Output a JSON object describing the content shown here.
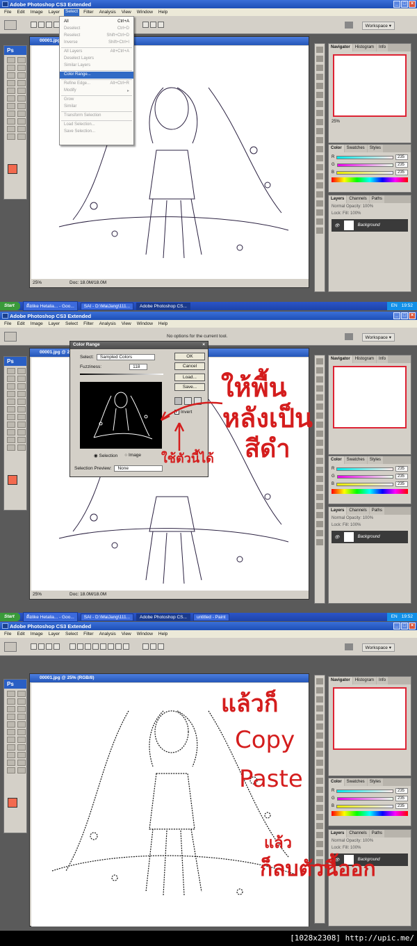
{
  "app": {
    "title": "Adobe Photoshop CS3 Extended",
    "workspace_label": "Workspace ▾",
    "ps_badge": "Ps"
  },
  "menu": [
    "File",
    "Edit",
    "Image",
    "Layer",
    "Select",
    "Filter",
    "Analysis",
    "View",
    "Window",
    "Help"
  ],
  "select_menu": [
    {
      "label": "All",
      "shortcut": "Ctrl+A",
      "enabled": true
    },
    {
      "label": "Deselect",
      "shortcut": "Ctrl+D",
      "enabled": false
    },
    {
      "label": "Reselect",
      "shortcut": "Shift+Ctrl+D",
      "enabled": false
    },
    {
      "label": "Inverse",
      "shortcut": "Shift+Ctrl+I",
      "enabled": false
    },
    {
      "sep": true
    },
    {
      "label": "All Layers",
      "shortcut": "Alt+Ctrl+A",
      "enabled": false
    },
    {
      "label": "Deselect Layers",
      "shortcut": "",
      "enabled": false
    },
    {
      "label": "Similar Layers",
      "shortcut": "",
      "enabled": false
    },
    {
      "sep": true
    },
    {
      "label": "Color Range...",
      "shortcut": "",
      "enabled": true,
      "highlight": true
    },
    {
      "sep": true
    },
    {
      "label": "Refine Edge...",
      "shortcut": "Alt+Ctrl+R",
      "enabled": false
    },
    {
      "label": "Modify",
      "shortcut": "▸",
      "enabled": false
    },
    {
      "sep": true
    },
    {
      "label": "Grow",
      "shortcut": "",
      "enabled": false
    },
    {
      "label": "Similar",
      "shortcut": "",
      "enabled": false
    },
    {
      "sep": true
    },
    {
      "label": "Transform Selection",
      "shortcut": "",
      "enabled": false
    },
    {
      "sep": true
    },
    {
      "label": "Load Selection...",
      "shortcut": "",
      "enabled": false
    },
    {
      "label": "Save Selection...",
      "shortcut": "",
      "enabled": false
    }
  ],
  "doc": {
    "title_1": "00001.jpg",
    "title_2": "00001.jpg @ 25%",
    "title_3": "00001.jpg @ 25% (RGB/8)",
    "zoom": "25%",
    "doc_size": "Doc: 18.0M/18.0M"
  },
  "options_text_2": "No options for the current tool.",
  "navigator": {
    "tabs": [
      "Navigator",
      "Histogram",
      "Info"
    ],
    "zoom": "25%"
  },
  "color_panel": {
    "tabs": [
      "Color",
      "Swatches",
      "Styles"
    ],
    "channels": [
      {
        "name": "R",
        "value": "235"
      },
      {
        "name": "G",
        "value": "235"
      },
      {
        "name": "B",
        "value": "235"
      }
    ],
    "fg_color": "#f26a4f"
  },
  "layers_panel": {
    "tabs": [
      "Layers",
      "Channels",
      "Paths"
    ],
    "blend": "Normal",
    "opacity_label": "Opacity:",
    "opacity": "100%",
    "lock_label": "Lock:",
    "fill_label": "Fill:",
    "fill": "100%",
    "layer_name": "Background"
  },
  "color_range": {
    "title": "Color Range",
    "select_label": "Select:",
    "select_value": "Sampled Colors",
    "fuzziness_label": "Fuzziness:",
    "fuzziness": "118",
    "buttons": [
      "OK",
      "Cancel",
      "Load...",
      "Save..."
    ],
    "invert_label": "Invert",
    "radio_selection": "Selection",
    "radio_image": "Image",
    "preview_label": "Selection Preview:",
    "preview_value": "None"
  },
  "taskbar_1": {
    "start": "Start",
    "tasks": [
      "คือlike Hetalia... - Goo...",
      "SAI - D:\\MaiJang\\111...",
      "Adobe Photoshop CS..."
    ],
    "tray_lang": "EN",
    "clock": "19:52"
  },
  "taskbar_2": {
    "start": "Start",
    "tasks": [
      "คือlike Hetalia... - Goo...",
      "SAI - D:\\MaiJang\\111...",
      "Adobe Photoshop CS...",
      "untitled - Paint"
    ],
    "tray_lang": "EN",
    "clock": "19:52"
  },
  "annotations": {
    "p2_line1": "ให้พื้น",
    "p2_line2": "หลังเป็น",
    "p2_line3": "สีดำ",
    "p2_tool": "ใช้ตัวนี้ได้",
    "p3_line1": "แล้วก็",
    "p3_line2": "Copy",
    "p3_line3": "Paste",
    "p3_line4": "แล้ว",
    "p3_line5": "ก็ลบตัวนี้ออก"
  },
  "credit": "[1028x2308] http://upic.me/",
  "colors": {
    "annotation": "#d41d1d",
    "titlebar": "#2456b8",
    "panel": "#d4d0c8",
    "workarea": "#5a5a5a"
  }
}
